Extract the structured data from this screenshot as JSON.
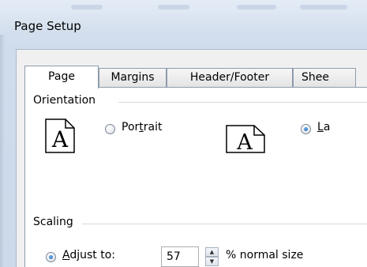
{
  "window": {
    "title": "Page Setup"
  },
  "tabs": [
    {
      "label": "Page",
      "active": true
    },
    {
      "label": "Margins",
      "active": false
    },
    {
      "label": "Header/Footer",
      "active": false
    },
    {
      "label": "Shee",
      "active": false
    }
  ],
  "orientation": {
    "label": "Orientation",
    "options": [
      {
        "label_pre": "Por",
        "label_acc": "t",
        "label_post": "rait",
        "selected": false,
        "icon": "portrait-page-icon",
        "glyph": "A"
      },
      {
        "label_pre": "",
        "label_acc": "L",
        "label_post": "a",
        "selected": true,
        "icon": "landscape-page-icon",
        "glyph": "A"
      }
    ]
  },
  "scaling": {
    "label": "Scaling",
    "adjust_pre": "",
    "adjust_acc": "A",
    "adjust_post": "djust to:",
    "adjust_selected": true,
    "value": "57",
    "suffix": "% normal size"
  },
  "colors": {
    "tab_border": "#8e9bab",
    "radio_dot": "#1e5fae",
    "title_bg": "#d2deec"
  }
}
